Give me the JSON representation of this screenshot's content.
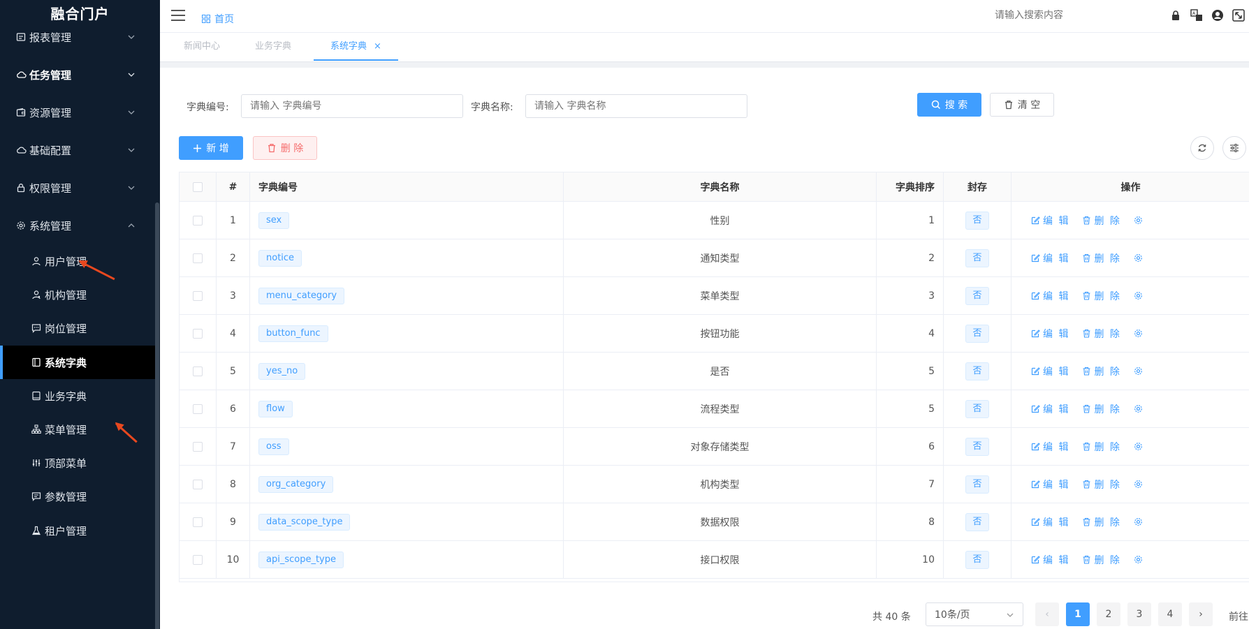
{
  "sidebar": {
    "logo": "融合门户",
    "groups": [
      {
        "label": "报表管理",
        "icon": "report-icon"
      },
      {
        "label": "任务管理",
        "icon": "cloud-icon"
      },
      {
        "label": "资源管理",
        "icon": "wallet-icon"
      },
      {
        "label": "基础配置",
        "icon": "cloud-config-icon"
      },
      {
        "label": "权限管理",
        "icon": "lock-icon"
      },
      {
        "label": "系统管理",
        "icon": "gear-icon"
      }
    ],
    "subitems": [
      {
        "label": "用户管理",
        "icon": "user-icon"
      },
      {
        "label": "机构管理",
        "icon": "org-user-icon"
      },
      {
        "label": "岗位管理",
        "icon": "chat-icon"
      },
      {
        "label": "系统字典",
        "icon": "book-icon"
      },
      {
        "label": "业务字典",
        "icon": "book-outline-icon"
      },
      {
        "label": "菜单管理",
        "icon": "tree-icon"
      },
      {
        "label": "顶部菜单",
        "icon": "sliders-icon"
      },
      {
        "label": "参数管理",
        "icon": "message-icon"
      },
      {
        "label": "租户管理",
        "icon": "flask-icon"
      }
    ]
  },
  "header": {
    "home": "首页",
    "search_placeholder": "请输入搜索内容"
  },
  "tabs": [
    {
      "label": "新闻中心"
    },
    {
      "label": "业务字典"
    },
    {
      "label": "系统字典",
      "close": "×"
    }
  ],
  "search_form": {
    "code_label": "字典编号:",
    "code_placeholder": "请输入 字典编号",
    "name_label": "字典名称:",
    "name_placeholder": "请输入 字典名称",
    "search_btn": "搜 索",
    "clear_btn": "清 空"
  },
  "toolbar": {
    "add_btn": "新 增",
    "delete_btn": "删 除"
  },
  "table": {
    "headers": {
      "index": "#",
      "code": "字典编号",
      "name": "字典名称",
      "sort": "字典排序",
      "sealed": "封存",
      "ops": "操作"
    },
    "edit_label": "编 辑",
    "delete_label": "删 除",
    "rows": [
      {
        "index": "1",
        "code": "sex",
        "name": "性别",
        "sort": "1",
        "sealed": "否"
      },
      {
        "index": "2",
        "code": "notice",
        "name": "通知类型",
        "sort": "2",
        "sealed": "否"
      },
      {
        "index": "3",
        "code": "menu_category",
        "name": "菜单类型",
        "sort": "3",
        "sealed": "否"
      },
      {
        "index": "4",
        "code": "button_func",
        "name": "按钮功能",
        "sort": "4",
        "sealed": "否"
      },
      {
        "index": "5",
        "code": "yes_no",
        "name": "是否",
        "sort": "5",
        "sealed": "否"
      },
      {
        "index": "6",
        "code": "flow",
        "name": "流程类型",
        "sort": "5",
        "sealed": "否"
      },
      {
        "index": "7",
        "code": "oss",
        "name": "对象存储类型",
        "sort": "6",
        "sealed": "否"
      },
      {
        "index": "8",
        "code": "org_category",
        "name": "机构类型",
        "sort": "7",
        "sealed": "否"
      },
      {
        "index": "9",
        "code": "data_scope_type",
        "name": "数据权限",
        "sort": "8",
        "sealed": "否"
      },
      {
        "index": "10",
        "code": "api_scope_type",
        "name": "接口权限",
        "sort": "10",
        "sealed": "否"
      }
    ]
  },
  "pagination": {
    "total": "共 40 条",
    "page_size": "10条/页",
    "pages": [
      "1",
      "2",
      "3",
      "4"
    ],
    "prev": "‹",
    "next": "›",
    "goto": "前往"
  },
  "colors": {
    "accent": "#409eff",
    "sidebar_bg": "#0f1d2e",
    "danger": "#f56c6c",
    "arrow": "#e8481f"
  }
}
